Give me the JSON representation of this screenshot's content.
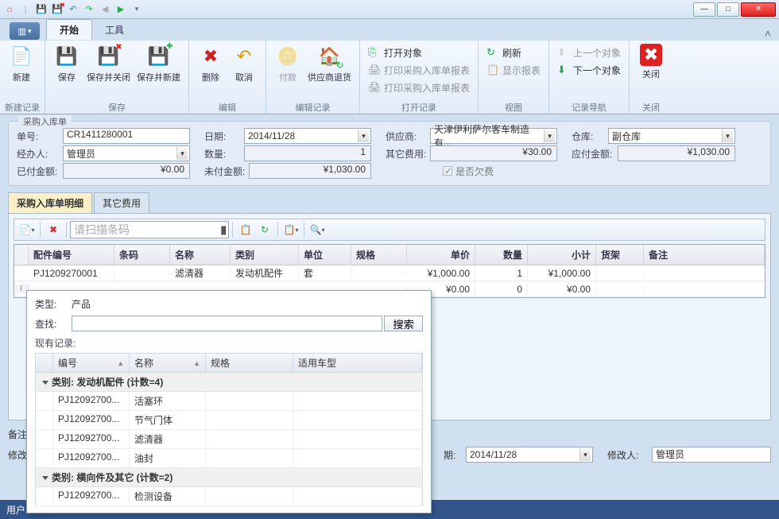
{
  "titlebar": {
    "quick_icons": [
      "home",
      "save",
      "save-close",
      "undo",
      "redo",
      "prev",
      "next",
      "dd"
    ]
  },
  "window_controls": {
    "min": "—",
    "max": "□",
    "close": "✕"
  },
  "ribbon": {
    "menu_label": "▥ ▾",
    "tabs": {
      "start": "开始",
      "tools": "工具"
    },
    "corner": "˄",
    "groups": {
      "new_record": {
        "label": "新建记录",
        "new": "新建"
      },
      "save": {
        "label": "保存",
        "save": "保存",
        "save_close": "保存并关闭",
        "save_new": "保存并新建"
      },
      "edit": {
        "label": "编辑",
        "delete": "删除",
        "cancel": "取消"
      },
      "edit_record": {
        "label": "编辑记录",
        "pay": "付款",
        "return": "供应商退货"
      },
      "open_record": {
        "label": "打开记录",
        "open_obj": "打开对象",
        "print_form": "打印采购入库单报表",
        "print_form2": "打印采购入库单报表"
      },
      "view": {
        "label": "视图",
        "refresh": "刷新",
        "show_report": "显示报表"
      },
      "nav": {
        "label": "记录导航",
        "prev": "上一个对象",
        "next": "下一个对象"
      },
      "close": {
        "label": "关闭",
        "close_btn": "关闭"
      }
    }
  },
  "form": {
    "legend": "采购入库单",
    "labels": {
      "orderno": "单号:",
      "date": "日期:",
      "supplier": "供应商:",
      "warehouse": "仓库:",
      "handler": "经办人:",
      "qty": "数量:",
      "other_fee": "其它费用:",
      "payable": "应付金额:",
      "paid": "已付金额:",
      "unpaid": "未付金额:",
      "is_owed": "是否欠费"
    },
    "values": {
      "orderno": "CR1411280001",
      "date": "2014/11/28",
      "supplier": "天津伊利萨尔客车制造有...",
      "warehouse": "副仓库",
      "handler": "管理员",
      "qty": "1",
      "other_fee": "¥30.00",
      "payable": "¥1,030.00",
      "paid": "¥0.00",
      "unpaid": "¥1,030.00"
    }
  },
  "detail_tabs": {
    "tab1": "采购入库单明细",
    "tab2": "其它费用"
  },
  "detail_toolbar": {
    "barcode_placeholder": "请扫描条码"
  },
  "grid": {
    "headers": {
      "code": "配件编号",
      "barcode": "条码",
      "name": "名称",
      "category": "类别",
      "unit": "单位",
      "spec": "规格",
      "price": "单价",
      "qty": "数量",
      "subtotal": "小计",
      "shelf": "货架",
      "remark": "备注"
    },
    "rows": [
      {
        "code": "PJ1209270001",
        "barcode": "",
        "name": "滤清器",
        "category": "发动机配件",
        "unit": "套",
        "spec": "",
        "price": "¥1,000.00",
        "qty": "1",
        "subtotal": "¥1,000.00",
        "shelf": "",
        "remark": ""
      },
      {
        "code": "",
        "barcode": "",
        "name": "",
        "category": "",
        "unit": "",
        "spec": "",
        "price": "¥0.00",
        "qty": "0",
        "subtotal": "¥0.00",
        "shelf": "",
        "remark": ""
      }
    ],
    "row_indicator": "I"
  },
  "popup": {
    "type_label": "类型:",
    "type_value": "产品",
    "search_label": "查找:",
    "search_btn": "搜索",
    "existing_label": "现有记录:",
    "headers": {
      "code": "编号",
      "name": "名称",
      "spec": "规格",
      "model": "适用车型"
    },
    "groups": [
      {
        "title": "类别: 发动机配件 (计数=4)",
        "rows": [
          {
            "code": "PJ12092700...",
            "name": "活塞环"
          },
          {
            "code": "PJ12092700...",
            "name": "节气门体"
          },
          {
            "code": "PJ12092700...",
            "name": "滤清器"
          },
          {
            "code": "PJ12092700...",
            "name": "油封"
          }
        ]
      },
      {
        "title": "类别: 横向件及其它 (计数=2)",
        "rows": [
          {
            "code": "PJ12092700...",
            "name": "检测设备"
          }
        ]
      }
    ]
  },
  "bottom": {
    "remark_label": "备注",
    "modify_label": "修改",
    "date_label": "期:",
    "date_value": "2014/11/28",
    "modifier_label": "修改人:",
    "modifier_value": "管理员"
  },
  "status": {
    "user": "用户"
  }
}
